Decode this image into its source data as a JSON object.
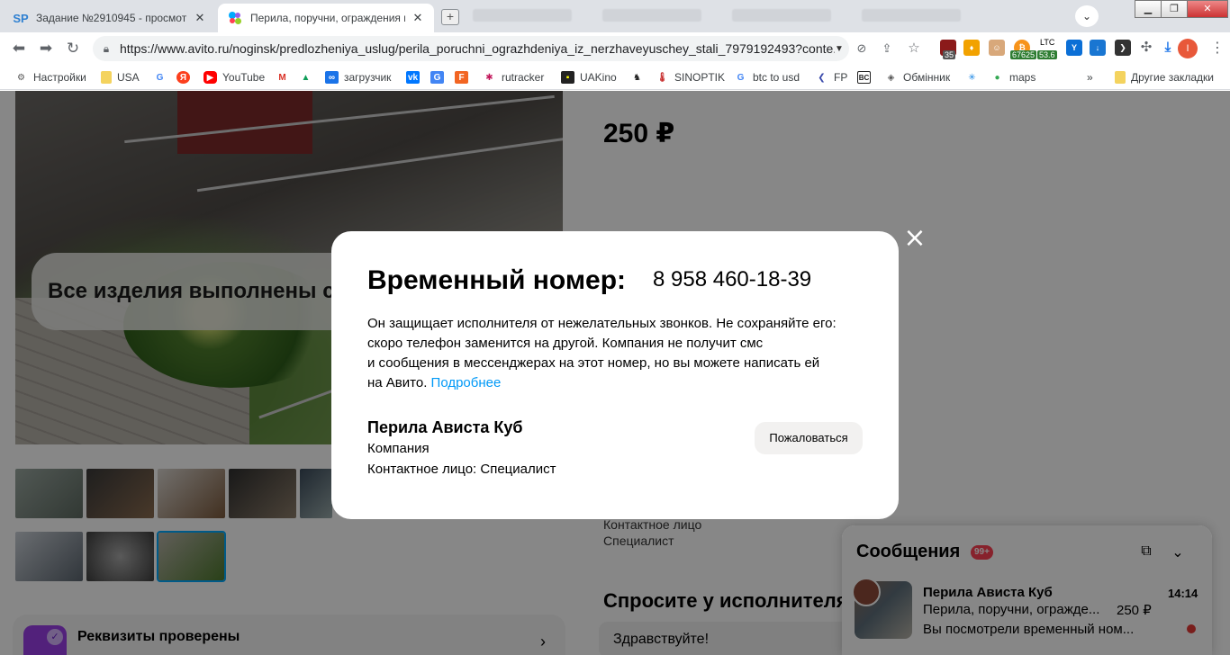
{
  "browser": {
    "tabs": [
      {
        "favicon": "SP",
        "title": "Задание №2910945 - просмотр з",
        "close": "✕"
      },
      {
        "favicon": "avito-icon",
        "title": "Перила, поручни, ограждения из",
        "close": "✕"
      }
    ],
    "url": "https://www.avito.ru/noginsk/predlozheniya_uslug/perila_poruchni_ograzhdeniya_iz_nerzhaveyuschey_stali_7979192493?conte...",
    "extensions": {
      "badge_35": "35",
      "btc_value": "67625",
      "ltc_label": "LTC",
      "ltc_value": "53.6",
      "profile_letter": "I"
    },
    "bookmarks": [
      {
        "label": "Настройки",
        "icon": "gear-icon"
      },
      {
        "label": "USA",
        "icon": "folder-icon"
      },
      {
        "label": "",
        "icon": "google-icon"
      },
      {
        "label": "",
        "icon": "yandex-icon"
      },
      {
        "label": "YouTube",
        "icon": "youtube-icon"
      },
      {
        "label": "",
        "icon": "gmail-icon"
      },
      {
        "label": "",
        "icon": "drive-icon"
      },
      {
        "label": "загрузчик",
        "icon": "loader-icon"
      },
      {
        "label": "",
        "icon": "vk-icon"
      },
      {
        "label": "",
        "icon": "translate-icon"
      },
      {
        "label": "",
        "icon": "f-icon"
      },
      {
        "label": "rutracker",
        "icon": "rutracker-icon"
      },
      {
        "label": "UAKino",
        "icon": "uakino-icon"
      },
      {
        "label": "",
        "icon": "chess-icon"
      },
      {
        "label": "SINOPTIK",
        "icon": "thermometer-icon"
      },
      {
        "label": "btc to usd",
        "icon": "google-icon"
      },
      {
        "label": "FP",
        "icon": "fp-icon"
      },
      {
        "label": "",
        "icon": "bc-icon"
      },
      {
        "label": "Обмінник",
        "icon": "exchange-icon"
      },
      {
        "label": "",
        "icon": "snowflake-icon"
      },
      {
        "label": "maps",
        "icon": "maps-icon"
      }
    ],
    "bookmarks_more": "»",
    "other_bookmarks": "Другие закладки"
  },
  "page": {
    "hero_caption": "Все изделия выполнены строго по ГОСТу",
    "price": "250 ₽",
    "contact_label": "Контактное лицо",
    "contact_value": "Специалист",
    "ask_title": "Спросите у исполнителя",
    "ask_input": "Здравствуйте!",
    "verified_title": "Реквизиты проверены"
  },
  "modal": {
    "title": "Временный номер:",
    "number": "8 958 460-18-39",
    "desc_line1": "Он защищает исполнителя от нежелательных звонков. Не сохраняйте его:",
    "desc_line2": "скоро телефон заменится на другой. Компания не получит смс",
    "desc_line3": "и сообщения в мессенджерах на этот номер, но вы можете написать ей",
    "desc_line4": "на Авито.",
    "more_link": "Подробнее",
    "company": "Перила Ависта Куб",
    "company_type": "Компания",
    "contact": "Контактное лицо: Специалист",
    "report_button": "Пожаловаться"
  },
  "messenger": {
    "title": "Сообщения",
    "badge": "99+",
    "chat_name": "Перила Ависта Куб",
    "time": "14:14",
    "item": "Перила, поручни, огражде...",
    "item_price": "250 ₽",
    "last_message": "Вы посмотрели временный ном..."
  },
  "colors": {
    "link": "#0099f7",
    "badge": "#ff4053",
    "overlay": "rgba(0,0,0,0.47)",
    "accent_selected_thumb": "#00aaff"
  }
}
